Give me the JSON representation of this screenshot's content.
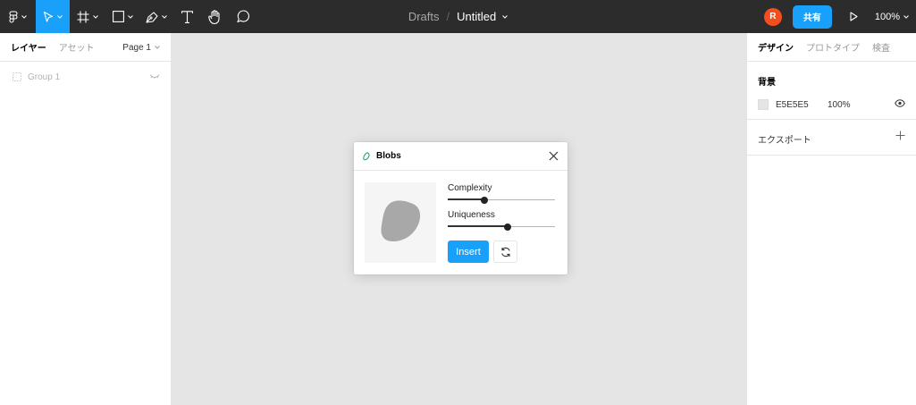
{
  "toolbar": {
    "breadcrumb": "Drafts",
    "separator": "/",
    "file_name": "Untitled",
    "avatar_initial": "R",
    "share_label": "共有",
    "zoom_label": "100%",
    "tools": [
      "main-menu-icon",
      "move-icon",
      "frame-icon",
      "rectangle-icon",
      "pen-icon",
      "text-icon",
      "hand-icon",
      "comment-icon"
    ]
  },
  "left_panel": {
    "tabs": [
      "レイヤー",
      "アセット"
    ],
    "page_label": "Page 1",
    "layers": [
      {
        "name": "Group 1"
      }
    ]
  },
  "right_panel": {
    "tabs": [
      "デザイン",
      "プロトタイプ",
      "検査"
    ],
    "background": {
      "title": "背景",
      "hex": "E5E5E5",
      "opacity": "100%",
      "color": "#e5e5e5"
    },
    "export_label": "エクスポート"
  },
  "plugin": {
    "title": "Blobs",
    "complexity_label": "Complexity",
    "complexity_value": 0.34,
    "uniqueness_label": "Uniqueness",
    "uniqueness_value": 0.56,
    "insert_label": "Insert"
  },
  "colors": {
    "toolbar": "#2c2c2c",
    "accent": "#18a0fb",
    "avatar": "#f24e1e",
    "canvas": "#e5e5e5",
    "blob": "#a8a8a8"
  }
}
